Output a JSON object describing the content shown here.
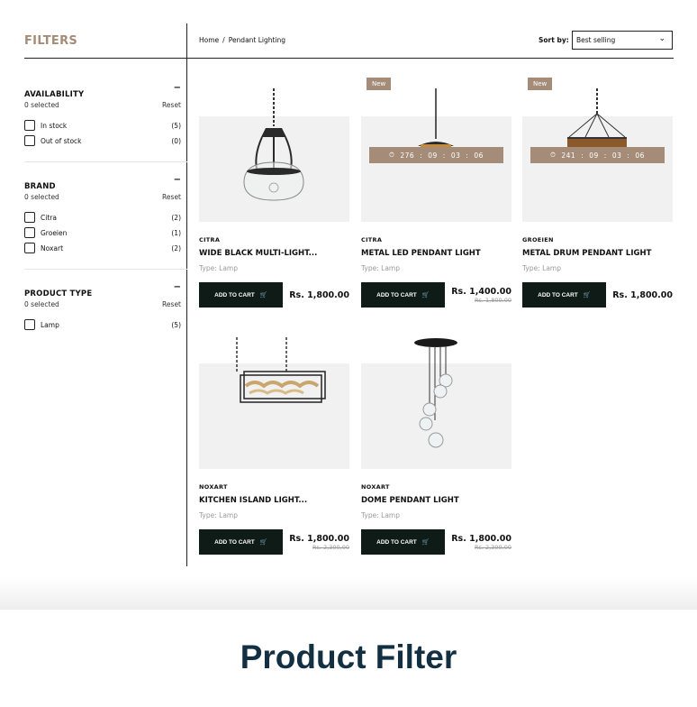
{
  "sidebar": {
    "title": "FILTERS",
    "groups": [
      {
        "title": "AVAILABILITY",
        "collapse": "−",
        "selected": "0 selected",
        "reset": "Reset",
        "options": [
          {
            "label": "In stock",
            "count": "(5)"
          },
          {
            "label": "Out of stock",
            "count": "(0)"
          }
        ]
      },
      {
        "title": "BRAND",
        "collapse": "−",
        "selected": "0 selected",
        "reset": "Reset",
        "options": [
          {
            "label": "Citra",
            "count": "(2)"
          },
          {
            "label": "Groeien",
            "count": "(1)"
          },
          {
            "label": "Noxart",
            "count": "(2)"
          }
        ]
      },
      {
        "title": "PRODUCT TYPE",
        "collapse": "−",
        "selected": "0 selected",
        "reset": "Reset",
        "options": [
          {
            "label": "Lamp",
            "count": "(5)"
          }
        ]
      }
    ]
  },
  "breadcrumb": {
    "home": "Home",
    "sep": "/",
    "current": "Pendant Lighting"
  },
  "sort": {
    "label": "Sort by:",
    "value": "Best selling",
    "icon": "chevron-down-icon"
  },
  "products": [
    {
      "brand": "CITRA",
      "title": "WIDE BLACK MULTI-LIGHT...",
      "type": "Type: Lamp",
      "cta": "ADD TO CART",
      "price": "Rs. 1,800.00",
      "compare": ""
    },
    {
      "brand": "CITRA",
      "title": "METAL LED PENDANT LIGHT",
      "type": "Type: Lamp",
      "cta": "ADD TO CART",
      "price": "Rs. 1,400.00",
      "compare": "Rs. 1,800.00",
      "badge": "New",
      "timer": {
        "d": "276",
        "h": "09",
        "m": "03",
        "s": "06"
      }
    },
    {
      "brand": "GROEIEN",
      "title": "METAL DRUM PENDANT LIGHT",
      "type": "Type: Lamp",
      "cta": "ADD TO CART",
      "price": "Rs. 1,800.00",
      "compare": "",
      "badge": "New",
      "timer": {
        "d": "241",
        "h": "09",
        "m": "03",
        "s": "06"
      }
    },
    {
      "brand": "NOXART",
      "title": "KITCHEN ISLAND LIGHT...",
      "type": "Type: Lamp",
      "cta": "ADD TO CART",
      "price": "Rs. 1,800.00",
      "compare": "Rs. 2,300.00"
    },
    {
      "brand": "NOXART",
      "title": "DOME PENDANT LIGHT",
      "type": "Type: Lamp",
      "cta": "ADD TO CART",
      "price": "Rs. 1,800.00",
      "compare": "Rs. 2,300.00"
    }
  ],
  "caption": "Product Filter",
  "colors": {
    "accent": "#a48c78",
    "button": "#0f1b17",
    "caption": "#123042"
  }
}
